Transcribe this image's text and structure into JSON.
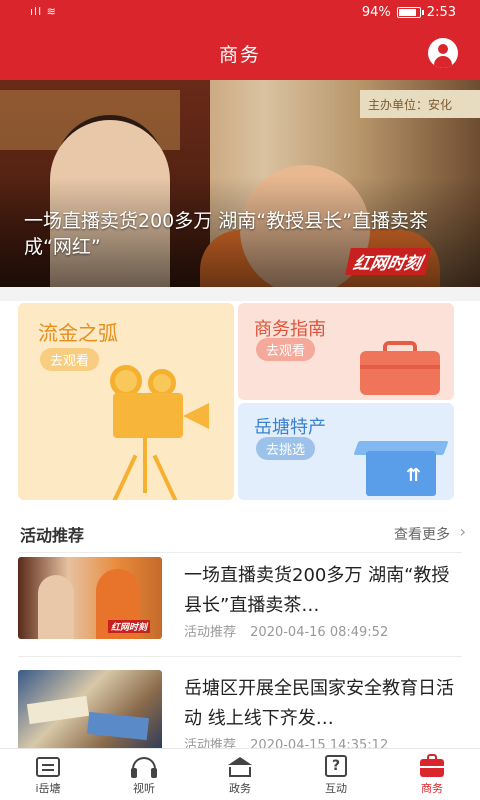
{
  "status_bar": {
    "signal": "⁴ᴳ.ıll ≡",
    "battery": "94%",
    "time": "2:53"
  },
  "header": {
    "title": "商务",
    "user_icon": "user-icon"
  },
  "banner": {
    "caption": "一场直播卖货200多万 湖南“教授县长”直播卖茶成“网红”",
    "sign_text": "主办单位：安化",
    "watermark": "红网时刻",
    "dot_count": 5,
    "active_dot": 0
  },
  "cards": {
    "big": {
      "name": "流金之弧",
      "action": "去观看"
    },
    "guide": {
      "name": "商务指南",
      "action": "去观看"
    },
    "local": {
      "name": "岳塘特产",
      "action": "去挑选"
    }
  },
  "section": {
    "title": "活动推荐",
    "more": "查看更多",
    "more_icon": "chevron-right-icon"
  },
  "news": [
    {
      "title": "一场直播卖货200多万 湖南“教授县长”直播卖茶…",
      "tag": "活动推荐",
      "time": "2020-04-16 08:49:52"
    },
    {
      "title": "岳塘区开展全民国家安全教育日活动 线上线下齐发…",
      "tag": "活动推荐",
      "time": "2020-04-15 14:35:12"
    }
  ],
  "tabbar": {
    "items": [
      {
        "label": "i岳塘",
        "icon": "document-icon"
      },
      {
        "label": "视听",
        "icon": "headphones-icon"
      },
      {
        "label": "政务",
        "icon": "government-building-icon"
      },
      {
        "label": "互动",
        "icon": "question-icon"
      },
      {
        "label": "商务",
        "icon": "briefcase-icon"
      }
    ],
    "active_index": 4
  },
  "colors": {
    "brand_red": "#d9252b",
    "card_big_bg": "#fde9c4",
    "card_guide_bg": "#fbe1d8",
    "card_local_bg": "#e2eefb"
  }
}
